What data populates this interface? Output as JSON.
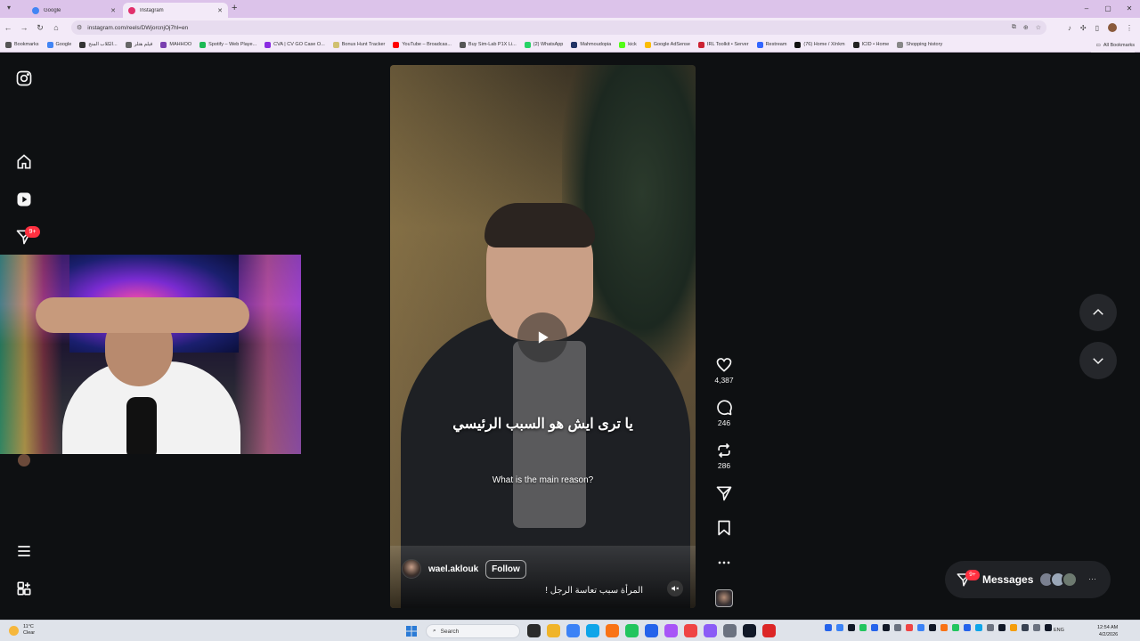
{
  "browser": {
    "tabs": [
      {
        "title": "Google",
        "active": false,
        "favicon_color": "#4285f4"
      },
      {
        "title": "Instagram",
        "active": true,
        "favicon_color": "#e1306c"
      }
    ],
    "new_tab_label": "+",
    "url": "instagram.com/reels/DWjorcnjOj7hl=en",
    "bookmarks": [
      {
        "label": "Bookmarks",
        "color": "#555555"
      },
      {
        "label": "Google",
        "color": "#4285f4"
      },
      {
        "label": "الكلاب المنح...",
        "color": "#333333"
      },
      {
        "label": "فيلم هتلر",
        "color": "#666666"
      },
      {
        "label": "MAHHOO",
        "color": "#7a3fb0"
      },
      {
        "label": "Spotify – Web Playe...",
        "color": "#1db954"
      },
      {
        "label": "CVA | CV GO Case O...",
        "color": "#8a2be2"
      },
      {
        "label": "Bonus Hunt Tracker",
        "color": "#d0c070"
      },
      {
        "label": "YouTube – Broadcas...",
        "color": "#ff0000"
      },
      {
        "label": "Buy Sim-Lab P1X Li...",
        "color": "#555555"
      },
      {
        "label": "(2) WhatsApp",
        "color": "#25d366"
      },
      {
        "label": "Mahmoudopia",
        "color": "#223366"
      },
      {
        "label": "kick",
        "color": "#53fc18"
      },
      {
        "label": "Google AdSense",
        "color": "#fbbc04"
      },
      {
        "label": "IRL Toolkit • Server",
        "color": "#cc2233"
      },
      {
        "label": "Restream",
        "color": "#3366ff"
      },
      {
        "label": "(76) Home / X/nkm",
        "color": "#111111"
      },
      {
        "label": "ICID • Home",
        "color": "#222222"
      },
      {
        "label": "Shopping history",
        "color": "#888888"
      }
    ],
    "all_bookmarks_label": "All Bookmarks",
    "window_controls": [
      "–",
      "▢",
      "✕"
    ]
  },
  "sidebar": {
    "notification_badge": "9+"
  },
  "reel": {
    "caption_ar": "يا ترى ايش هو السبب الرئيسي",
    "caption_en": "What is the main reason?",
    "username": "wael.aklouk",
    "follow_label": "Follow",
    "description": "المرأة سبب تعاسة الرجل !"
  },
  "actions": {
    "likes": "4,387",
    "comments": "246",
    "reposts": "286"
  },
  "messages": {
    "label": "Messages",
    "badge": "9+",
    "avatar_colors": [
      "#7a8090",
      "#9aa7b8",
      "#6d7a70"
    ],
    "more": "···"
  },
  "taskbar": {
    "weather_temp": "11°C",
    "weather_desc": "Clear",
    "search_placeholder": "Search",
    "app_colors": [
      "#2b2b2b",
      "#f0b429",
      "#3b82f6",
      "#0ea5e9",
      "#f97316",
      "#22c55e",
      "#2563eb",
      "#a855f7",
      "#ef4444",
      "#8b5cf6",
      "#6b7280",
      "#111827",
      "#dc2626"
    ],
    "tray_colors": [
      "#2563eb",
      "#3b82f6",
      "#111827",
      "#22c55e",
      "#2563eb",
      "#111827",
      "#6b7280",
      "#ef4444",
      "#3b82f6",
      "#111827",
      "#f97316",
      "#22c55e",
      "#2563eb",
      "#0ea5e9",
      "#6b7280",
      "#111827",
      "#f59e0b",
      "#374151",
      "#6b7280",
      "#111827"
    ],
    "language": "ENG",
    "time": "12:54 AM",
    "date": "4/2/2026"
  }
}
